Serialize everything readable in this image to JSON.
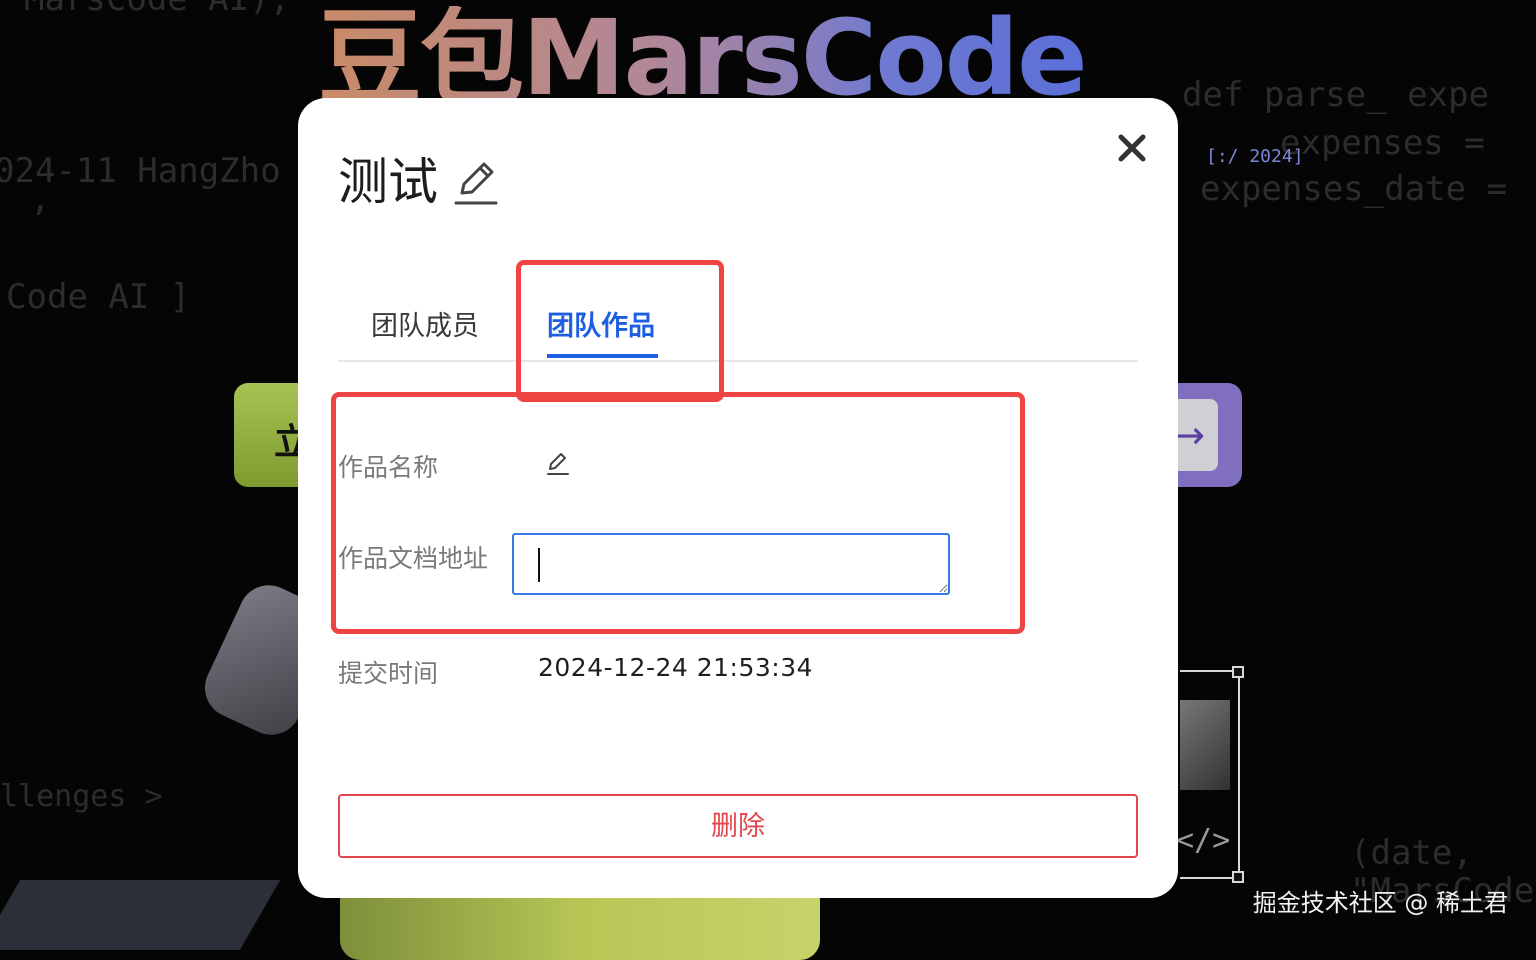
{
  "background": {
    "brand_title": "豆包MarsCode",
    "code_lines": [
      "MarsCode AI);",
      "024-11 HangZho",
      ",",
      "Code AI ]",
      "llenges >",
      "def parse_ expe",
      "expenses =",
      "expenses_date =",
      "(date,",
      "\"MarsCode\""
    ],
    "year_tag": "[:/ 2024]",
    "left_button_glyph": "立",
    "right_button_arrow": "→",
    "code_tag": "</>"
  },
  "watermark": "掘金技术社区 @ 稀土君",
  "modal": {
    "title": "测试",
    "close_glyph": "✕",
    "tabs": [
      {
        "label": "团队成员",
        "active": false
      },
      {
        "label": "团队作品",
        "active": true
      }
    ],
    "fields": {
      "work_name_label": "作品名称",
      "work_name_value": "",
      "doc_url_label": "作品文档地址",
      "doc_url_value": "",
      "submit_time_label": "提交时间",
      "submit_time_value": "2024-12-24 21:53:34"
    },
    "delete_label": "删除"
  },
  "colors": {
    "accent": "#1d5fe0",
    "danger": "#e0474c",
    "annotation": "#ef4444",
    "input_border": "#3b78e7"
  }
}
